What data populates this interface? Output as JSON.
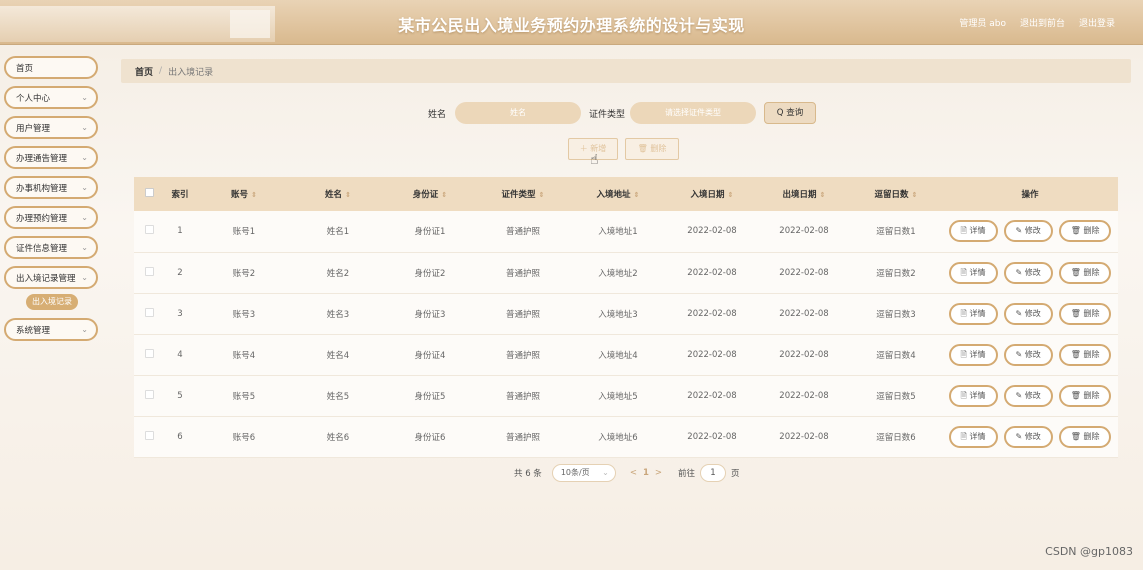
{
  "header": {
    "title": "某市公民出入境业务预约办理系统的设计与实现",
    "user": "管理员 abo",
    "back_link": "退出到前台",
    "logout_link": "退出登录"
  },
  "sidebar": {
    "items": [
      {
        "label": "首页",
        "chevron": ""
      },
      {
        "label": "个人中心",
        "chevron": "⌄"
      },
      {
        "label": "用户管理",
        "chevron": "⌄"
      },
      {
        "label": "办理通告管理",
        "chevron": "⌄"
      },
      {
        "label": "办事机构管理",
        "chevron": "⌄"
      },
      {
        "label": "办理预约管理",
        "chevron": "⌄"
      },
      {
        "label": "证件信息管理",
        "chevron": "⌄"
      },
      {
        "label": "出入境记录管理",
        "chevron": "⌄"
      },
      {
        "label": "系统管理",
        "chevron": "⌄"
      }
    ],
    "sub_item": "出入境记录"
  },
  "breadcrumb": {
    "home": "首页",
    "sep": "/",
    "current": "出入境记录"
  },
  "search": {
    "name_label": "姓名",
    "name_placeholder": "姓名",
    "type_label": "证件类型",
    "type_placeholder": "请选择证件类型",
    "query_button": "Q 查询"
  },
  "actions": {
    "add": "＋ 新增",
    "delete": "🗑 删除"
  },
  "table": {
    "headers": [
      "索引",
      "账号",
      "姓名",
      "身份证",
      "证件类型",
      "入境地址",
      "入境日期",
      "出境日期",
      "逗留日数",
      "操作"
    ],
    "sort_glyph": "⇕",
    "rows": [
      [
        "1",
        "账号1",
        "姓名1",
        "身份证1",
        "普通护照",
        "入境地址1",
        "2022-02-08",
        "2022-02-08",
        "逗留日数1"
      ],
      [
        "2",
        "账号2",
        "姓名2",
        "身份证2",
        "普通护照",
        "入境地址2",
        "2022-02-08",
        "2022-02-08",
        "逗留日数2"
      ],
      [
        "3",
        "账号3",
        "姓名3",
        "身份证3",
        "普通护照",
        "入境地址3",
        "2022-02-08",
        "2022-02-08",
        "逗留日数3"
      ],
      [
        "4",
        "账号4",
        "姓名4",
        "身份证4",
        "普通护照",
        "入境地址4",
        "2022-02-08",
        "2022-02-08",
        "逗留日数4"
      ],
      [
        "5",
        "账号5",
        "姓名5",
        "身份证5",
        "普通护照",
        "入境地址5",
        "2022-02-08",
        "2022-02-08",
        "逗留日数5"
      ],
      [
        "6",
        "账号6",
        "姓名6",
        "身份证6",
        "普通护照",
        "入境地址6",
        "2022-02-08",
        "2022-02-08",
        "逗留日数6"
      ]
    ],
    "row_actions": {
      "detail": "🗎 详情",
      "edit": "✎ 修改",
      "delete": "🗑 删除"
    }
  },
  "pagination": {
    "total": "共 6 条",
    "page_size": "10条/页",
    "prev": "<",
    "current": "1",
    "next": ">",
    "goto_label": "前往",
    "goto_value": "1",
    "page_suffix": "页"
  },
  "watermark": "CSDN @gp1083",
  "colors": {
    "accent": "#d4aa72",
    "header_bg": "#dcbd92",
    "table_head": "#efdcc1"
  }
}
